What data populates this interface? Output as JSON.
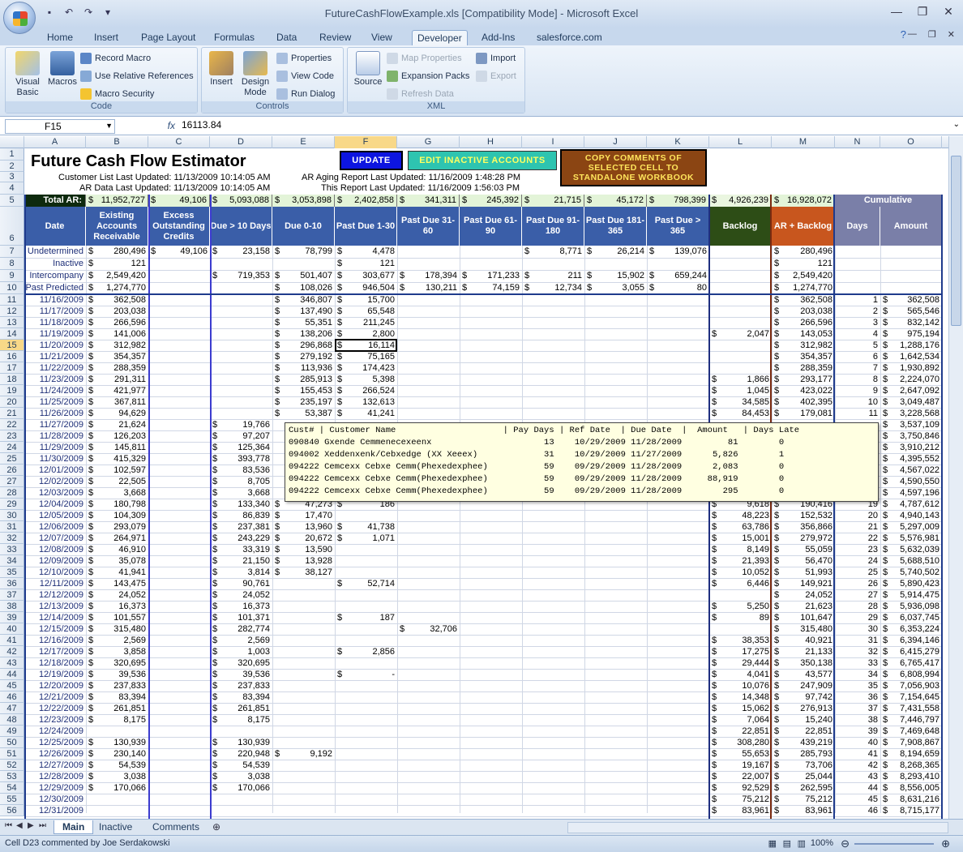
{
  "window": {
    "title": "FutureCashFlowExample.xls  [Compatibility Mode] - Microsoft Excel"
  },
  "ribbon_tabs": [
    "Home",
    "Insert",
    "Page Layout",
    "Formulas",
    "Data",
    "Review",
    "View",
    "Developer",
    "Add-Ins",
    "salesforce.com"
  ],
  "active_tab": "Developer",
  "ribbon": {
    "code": {
      "title": "Code",
      "visual_basic": "Visual Basic",
      "macros": "Macros",
      "record": "Record Macro",
      "relative": "Use Relative References",
      "security": "Macro Security"
    },
    "controls": {
      "title": "Controls",
      "insert": "Insert",
      "design": "Design Mode",
      "properties": "Properties",
      "view_code": "View Code",
      "run_dialog": "Run Dialog"
    },
    "xml": {
      "title": "XML",
      "source": "Source",
      "map_props": "Map Properties",
      "expansion": "Expansion Packs",
      "refresh": "Refresh Data",
      "import": "Import",
      "export": "Export"
    }
  },
  "formula_bar": {
    "name": "F15",
    "fx": "fx",
    "value": "16113.84"
  },
  "columns": [
    "A",
    "B",
    "C",
    "D",
    "E",
    "F",
    "G",
    "H",
    "I",
    "J",
    "K",
    "L",
    "M",
    "N",
    "O"
  ],
  "sheet": {
    "title": "Future Cash Flow Estimator",
    "btn_update": "UPDATE",
    "btn_edit": "EDIT INACTIVE ACCOUNTS",
    "btn_copy": "COPY COMMENTS OF SELECTED CELL TO STANDALONE WORKBOOK",
    "cust_list": "Customer List Last Updated:  11/13/2009  10:14:05 AM",
    "ar_data": "AR Data Last Updated:  11/13/2009  10:14:05 AM",
    "ar_aging": "AR Aging Report Last Updated:  11/16/2009  1:48:28 PM",
    "this_report": "This Report Last Updated:  11/16/2009  1:56:03 PM",
    "total_label": "Total AR:",
    "totals": [
      "$ 11,952,727",
      "$ 49,106",
      "$ 5,093,088",
      "$ 3,053,898",
      "$ 2,402,858",
      "$ 341,311",
      "$ 245,392",
      "$ 21,715",
      "$ 45,172",
      "$ 798,399",
      "$ 4,926,239",
      "$ 16,928,072"
    ],
    "cumulative": "Cumulative",
    "headers": [
      "Date",
      "Existing Accounts Receivable",
      "Excess Outstanding Credits",
      "Due > 10 Days",
      "Due 0-10",
      "Past Due 1-30",
      "Past Due 31-60",
      "Past Due 61-90",
      "Past Due 91-180",
      "Past Due 181-365",
      "Past Due > 365",
      "Backlog",
      "AR + Backlog",
      "Days",
      "Amount"
    ]
  },
  "rows_top": [
    {
      "a": "Undetermined",
      "b": "280,496",
      "c": "49,106",
      "d": "23,158",
      "e": "78,799",
      "f": "4,478",
      "i": "8,771",
      "j": "26,214",
      "k": "139,076",
      "m": "280,496"
    },
    {
      "a": "Inactive",
      "b": "121",
      "f": "121",
      "m": "121"
    },
    {
      "a": "Intercompany",
      "b": "2,549,420",
      "d": "719,353",
      "e": "501,407",
      "f": "303,677",
      "g": "178,394",
      "h": "171,233",
      "i": "211",
      "j": "15,902",
      "k": "659,244",
      "m": "2,549,420"
    },
    {
      "a": "Past Predicted",
      "b": "1,274,770",
      "e": "108,026",
      "f": "946,504",
      "g": "130,211",
      "h": "74,159",
      "i": "12,734",
      "j": "3,055",
      "k": "80",
      "m": "1,274,770"
    }
  ],
  "rows": [
    {
      "r": 11,
      "a": "11/16/2009",
      "b": "362,508",
      "e": "346,807",
      "f": "15,700",
      "m": "362,508",
      "n": "1",
      "o": "362,508"
    },
    {
      "r": 12,
      "a": "11/17/2009",
      "b": "203,038",
      "e": "137,490",
      "f": "65,548",
      "m": "203,038",
      "n": "2",
      "o": "565,546"
    },
    {
      "r": 13,
      "a": "11/18/2009",
      "b": "266,596",
      "e": "55,351",
      "f": "211,245",
      "m": "266,596",
      "n": "3",
      "o": "832,142"
    },
    {
      "r": 14,
      "a": "11/19/2009",
      "b": "141,006",
      "e": "138,206",
      "f": "2,800",
      "l": "2,047",
      "m": "143,053",
      "n": "4",
      "o": "975,194"
    },
    {
      "r": 15,
      "a": "11/20/2009",
      "b": "312,982",
      "e": "296,868",
      "f": "16,114",
      "m": "312,982",
      "n": "5",
      "o": "1,288,176"
    },
    {
      "r": 16,
      "a": "11/21/2009",
      "b": "354,357",
      "e": "279,192",
      "f": "75,165",
      "m": "354,357",
      "n": "6",
      "o": "1,642,534"
    },
    {
      "r": 17,
      "a": "11/22/2009",
      "b": "288,359",
      "e": "113,936",
      "f": "174,423",
      "m": "288,359",
      "n": "7",
      "o": "1,930,892"
    },
    {
      "r": 18,
      "a": "11/23/2009",
      "b": "291,311",
      "e": "285,913",
      "f": "5,398",
      "l": "1,866",
      "m": "293,177",
      "n": "8",
      "o": "2,224,070"
    },
    {
      "r": 19,
      "a": "11/24/2009",
      "b": "421,977",
      "e": "155,453",
      "f": "266,524",
      "l": "1,045",
      "m": "423,022",
      "n": "9",
      "o": "2,647,092"
    },
    {
      "r": 20,
      "a": "11/25/2009",
      "b": "367,811",
      "e": "235,197",
      "f": "132,613",
      "l": "34,585",
      "m": "402,395",
      "n": "10",
      "o": "3,049,487"
    },
    {
      "r": 21,
      "a": "11/26/2009",
      "b": "94,629",
      "e": "53,387",
      "f": "41,241",
      "l": "84,453",
      "m": "179,081",
      "n": "11",
      "o": "3,228,568"
    },
    {
      "r": 22,
      "a": "11/27/2009",
      "b": "21,624",
      "d": "19,766",
      "o": "3,537,109"
    },
    {
      "r": 23,
      "a": "11/28/2009",
      "b": "126,203",
      "d": "97,207",
      "o": "3,750,846"
    },
    {
      "r": 24,
      "a": "11/29/2009",
      "b": "145,811",
      "d": "125,364",
      "o": "3,910,212"
    },
    {
      "r": 25,
      "a": "11/30/2009",
      "b": "415,329",
      "d": "393,778",
      "o": "4,395,552"
    },
    {
      "r": 26,
      "a": "12/01/2009",
      "b": "102,597",
      "d": "83,536",
      "o": "4,567,022"
    },
    {
      "r": 27,
      "a": "12/02/2009",
      "b": "22,505",
      "d": "8,705",
      "o": "4,590,550"
    },
    {
      "r": 28,
      "a": "12/03/2009",
      "b": "3,668",
      "d": "3,668",
      "o": "4,597,196"
    },
    {
      "r": 29,
      "a": "12/04/2009",
      "b": "180,798",
      "d": "133,340",
      "e": "47,273",
      "f": "186",
      "l": "9,618",
      "m": "190,416",
      "n": "19",
      "o": "4,787,612"
    },
    {
      "r": 30,
      "a": "12/05/2009",
      "b": "104,309",
      "d": "86,839",
      "e": "17,470",
      "l": "48,223",
      "m": "152,532",
      "n": "20",
      "o": "4,940,143"
    },
    {
      "r": 31,
      "a": "12/06/2009",
      "b": "293,079",
      "d": "237,381",
      "e": "13,960",
      "f": "41,738",
      "l": "63,786",
      "m": "356,866",
      "n": "21",
      "o": "5,297,009"
    },
    {
      "r": 32,
      "a": "12/07/2009",
      "b": "264,971",
      "d": "243,229",
      "e": "20,672",
      "f": "1,071",
      "l": "15,001",
      "m": "279,972",
      "n": "22",
      "o": "5,576,981"
    },
    {
      "r": 33,
      "a": "12/08/2009",
      "b": "46,910",
      "d": "33,319",
      "e": "13,590",
      "l": "8,149",
      "m": "55,059",
      "n": "23",
      "o": "5,632,039"
    },
    {
      "r": 34,
      "a": "12/09/2009",
      "b": "35,078",
      "d": "21,150",
      "e": "13,928",
      "l": "21,393",
      "m": "56,470",
      "n": "24",
      "o": "5,688,510"
    },
    {
      "r": 35,
      "a": "12/10/2009",
      "b": "41,941",
      "d": "3,814",
      "e": "38,127",
      "l": "10,052",
      "m": "51,993",
      "n": "25",
      "o": "5,740,502"
    },
    {
      "r": 36,
      "a": "12/11/2009",
      "b": "143,475",
      "d": "90,761",
      "f": "52,714",
      "l": "6,446",
      "m": "149,921",
      "n": "26",
      "o": "5,890,423"
    },
    {
      "r": 37,
      "a": "12/12/2009",
      "b": "24,052",
      "d": "24,052",
      "m": "24,052",
      "n": "27",
      "o": "5,914,475"
    },
    {
      "r": 38,
      "a": "12/13/2009",
      "b": "16,373",
      "d": "16,373",
      "l": "5,250",
      "m": "21,623",
      "n": "28",
      "o": "5,936,098"
    },
    {
      "r": 39,
      "a": "12/14/2009",
      "b": "101,557",
      "d": "101,371",
      "f": "187",
      "l": "89",
      "m": "101,647",
      "n": "29",
      "o": "6,037,745"
    },
    {
      "r": 40,
      "a": "12/15/2009",
      "b": "315,480",
      "d": "282,774",
      "g": "32,706",
      "m": "315,480",
      "n": "30",
      "o": "6,353,224"
    },
    {
      "r": 41,
      "a": "12/16/2009",
      "b": "2,569",
      "d": "2,569",
      "l": "38,353",
      "m": "40,921",
      "n": "31",
      "o": "6,394,146"
    },
    {
      "r": 42,
      "a": "12/17/2009",
      "b": "3,858",
      "d": "1,003",
      "f": "2,856",
      "l": "17,275",
      "m": "21,133",
      "n": "32",
      "o": "6,415,279"
    },
    {
      "r": 43,
      "a": "12/18/2009",
      "b": "320,695",
      "d": "320,695",
      "l": "29,444",
      "m": "350,138",
      "n": "33",
      "o": "6,765,417"
    },
    {
      "r": 44,
      "a": "12/19/2009",
      "b": "39,536",
      "d": "39,536",
      "f": "-",
      "l": "4,041",
      "m": "43,577",
      "n": "34",
      "o": "6,808,994"
    },
    {
      "r": 45,
      "a": "12/20/2009",
      "b": "237,833",
      "d": "237,833",
      "l": "10,076",
      "m": "247,909",
      "n": "35",
      "o": "7,056,903"
    },
    {
      "r": 46,
      "a": "12/21/2009",
      "b": "83,394",
      "d": "83,394",
      "l": "14,348",
      "m": "97,742",
      "n": "36",
      "o": "7,154,645"
    },
    {
      "r": 47,
      "a": "12/22/2009",
      "b": "261,851",
      "d": "261,851",
      "l": "15,062",
      "m": "276,913",
      "n": "37",
      "o": "7,431,558"
    },
    {
      "r": 48,
      "a": "12/23/2009",
      "b": "8,175",
      "d": "8,175",
      "l": "7,064",
      "m": "15,240",
      "n": "38",
      "o": "7,446,797"
    },
    {
      "r": 49,
      "a": "12/24/2009",
      "l": "22,851",
      "m": "22,851",
      "n": "39",
      "o": "7,469,648"
    },
    {
      "r": 50,
      "a": "12/25/2009",
      "b": "130,939",
      "d": "130,939",
      "l": "308,280",
      "m": "439,219",
      "n": "40",
      "o": "7,908,867"
    },
    {
      "r": 51,
      "a": "12/26/2009",
      "b": "230,140",
      "d": "220,948",
      "e": "9,192",
      "l": "55,653",
      "m": "285,793",
      "n": "41",
      "o": "8,194,659"
    },
    {
      "r": 52,
      "a": "12/27/2009",
      "b": "54,539",
      "d": "54,539",
      "l": "19,167",
      "m": "73,706",
      "n": "42",
      "o": "8,268,365"
    },
    {
      "r": 53,
      "a": "12/28/2009",
      "b": "3,038",
      "d": "3,038",
      "l": "22,007",
      "m": "25,044",
      "n": "43",
      "o": "8,293,410"
    },
    {
      "r": 54,
      "a": "12/29/2009",
      "b": "170,066",
      "d": "170,066",
      "l": "92,529",
      "m": "262,595",
      "n": "44",
      "o": "8,556,005"
    },
    {
      "r": 55,
      "a": "12/30/2009",
      "l": "75,212",
      "m": "75,212",
      "n": "45",
      "o": "8,631,216"
    },
    {
      "r": 56,
      "a": "12/31/2009",
      "l": "83,961",
      "m": "83,961",
      "n": "46",
      "o": "8,715,177"
    }
  ],
  "tooltip": {
    "header": "Cust# | Customer Name                     | Pay Days | Ref Date  | Due Date  |  Amount   | Days Late",
    "lines": [
      "090840 Gxende Cemmenecexeenx                      13    10/29/2009 11/28/2009         81        0",
      "094002 Xeddenxenk/Cebxedge (XX Xeeex)             31    10/29/2009 11/27/2009      5,826        1",
      "094222 Cemcexx Cebxe Cemm(Phexedexphee)           59    09/29/2009 11/28/2009      2,083        0",
      "094222 Cemcexx Cebxe Cemm(Phexedexphee)           59    09/29/2009 11/28/2009     88,919        0",
      "094222 Cemcexx Cebxe Cemm(Phexedexphee)           59    09/29/2009 11/28/2009        295        0"
    ]
  },
  "sheet_tabs": [
    "Main",
    "Inactive",
    "Comments"
  ],
  "status": {
    "message": "Cell D23 commented by Joe Serdakowski",
    "zoom": "100%"
  }
}
